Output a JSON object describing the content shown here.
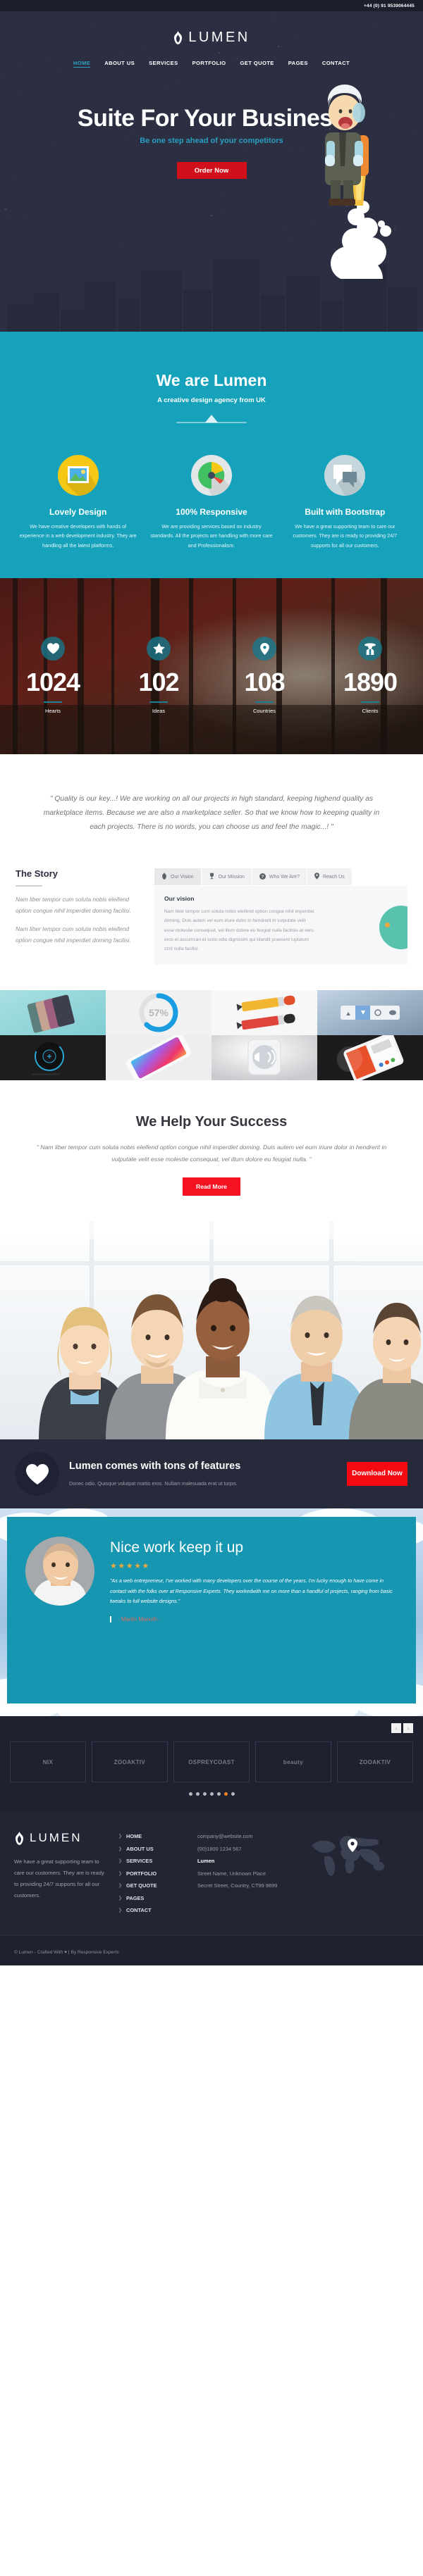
{
  "topbar": {
    "phone": "+44 (0) 91 9539064445"
  },
  "brand": {
    "name": "LUMEN",
    "icon": "flame-icon"
  },
  "nav": {
    "items": [
      {
        "label": "HOME",
        "active": true
      },
      {
        "label": "ABOUT US",
        "active": false
      },
      {
        "label": "SERVICES",
        "active": false
      },
      {
        "label": "PORTFOLIO",
        "active": false
      },
      {
        "label": "GET QUOTE",
        "active": false
      },
      {
        "label": "PAGES",
        "active": false
      },
      {
        "label": "CONTACT",
        "active": false
      }
    ]
  },
  "hero": {
    "title": "Suite For Your Business",
    "subtitle": "Be one step ahead of your competitors",
    "cta": "Order Now",
    "accent": "#2a9ec0",
    "cta_color": "#d0111b",
    "bg": "#2b2f41"
  },
  "about": {
    "heading": "We are Lumen",
    "lead": "A creative design agency from UK",
    "bg": "#17a2bc",
    "features": [
      {
        "icon": "image-icon",
        "title": "Lovely Design",
        "text": "We have creative developers with hands of experience in a web development industry. They are handling all the latest platforms."
      },
      {
        "icon": "pie-chart-icon",
        "title": "100% Responsive",
        "text": "We are providing services based on industry standards. All the projects are handling with more care and Professionalism."
      },
      {
        "icon": "chat-bubble-icon",
        "title": "Built with Bootstrap",
        "text": "We have a great supporting team to care our customers. They are is ready to providing 24/7 supports for all our customers."
      }
    ]
  },
  "counters": [
    {
      "icon": "heart-icon",
      "glyph": "♥",
      "value": "1024",
      "label": "Hearts"
    },
    {
      "icon": "star-icon",
      "glyph": "★",
      "value": "102",
      "label": "Ideas"
    },
    {
      "icon": "map-pin-icon",
      "glyph": "☰",
      "value": "108",
      "label": "Countries"
    },
    {
      "icon": "detective-icon",
      "glyph": "☃",
      "value": "1890",
      "label": "Clients"
    }
  ],
  "quote": {
    "text": "\" Quality is our key...! We are working on all our projects in high standard, keeping highend quality as marketplace items. Because we are also a marketplace seller. So that we know how to keeping quality in each projects. There is no words, you can choose us and feel the magic...! \""
  },
  "story": {
    "title": "The Story",
    "paragraphs": [
      "Nam liber tempor cum soluta nobis eleifend option congue nihil imperdiet doming facilisi.",
      "Nam liber tempor cum soluta nobis eleifend option congue nihil imperdiet doming facilisi."
    ],
    "tabs": [
      {
        "label": "Our Vision",
        "icon": "flame-icon",
        "glyph": "☘",
        "active": true
      },
      {
        "label": "Our Mission",
        "icon": "trophy-icon",
        "glyph": "♙",
        "active": false
      },
      {
        "label": "Who We Are?",
        "icon": "question-circle-icon",
        "glyph": "❓",
        "active": false
      },
      {
        "label": "Reach Us",
        "icon": "map-pin-icon",
        "glyph": "⚑",
        "active": false
      }
    ],
    "panel": {
      "heading": "Our vision",
      "text": "Nam liber tempor cum soluta nobis eleifend option congue nihil imperdiet doming. Duis autem vel eum iriure dolor in hendrerit in vulputate velit esse molestie consequat, vel illum dolore eu feugiat nulla facilisis at vero eros et accumsan et iusto odio dignissim qui blandit praesent luptatum zzril nulla facilisi."
    }
  },
  "portfolio": {
    "items": [
      {
        "name": "phone-cards-mockup",
        "label": ""
      },
      {
        "name": "progress-ring-57",
        "label": "57%"
      },
      {
        "name": "pencils-icon-set",
        "label": ""
      },
      {
        "name": "toolbar-ui-icons",
        "label": ""
      },
      {
        "name": "dark-dial-knob",
        "label": ""
      },
      {
        "name": "colorful-phone-mockup",
        "label": ""
      },
      {
        "name": "speaker-icon-3d",
        "label": ""
      },
      {
        "name": "orange-app-mockup",
        "label": ""
      }
    ]
  },
  "help": {
    "heading": "We Help Your Success",
    "text": "\" Nam liber tempor cum soluta nobis eleifend option congue nihil imperdiet doming. Duis autem vel eum iriure dolor in hendrerit in vulputate velit esse molestie consequat, vel illum dolore eu feugiat nulla. \"",
    "cta": "Read More",
    "cta_color": "#f51322"
  },
  "cta": {
    "icon": "heart-icon",
    "heading": "Lumen comes with tons of features",
    "text": "Donec odio. Quisque volutpat mattis eros. Nullam malesuada erat ut turpis.",
    "button": "Download Now",
    "button_color": "#f40913",
    "bg": "#262a3b"
  },
  "testimonial": {
    "heading": "Nice work keep it up",
    "rating": 5,
    "stars": "★★★★★",
    "text": "\"As a web entrepreneur, I've worked with many developers over the course of the years. I'm lucky enough to have come in contact with the folks over at Responsive Experts. They workedwith me on more than a handful of projects, ranging from basic tweaks to full website designs.\"",
    "author": "- Martin Manoth -",
    "bg": "#1796b1"
  },
  "clients": {
    "prev": "‹",
    "next": "›",
    "logos": [
      "NIX",
      "ZOOAKTIV",
      "OSPREYCOAST",
      "beauty",
      "ZOOAKTIV"
    ],
    "dots": 7,
    "active_dot": 5,
    "active_color": "#f0861e"
  },
  "footer": {
    "brand": "LUMEN",
    "about": "We have a great supporting team to care our customers. They are is ready to providing 24/7 supports for all our customers.",
    "links": [
      "HOME",
      "ABOUT US",
      "SERVICES",
      "PORTFOLIO",
      "GET QUOTE",
      "PAGES",
      "CONTACT"
    ],
    "contact": {
      "email": "company@website.com",
      "phone": "(00)1800 1234 567",
      "name": "Lumen",
      "address1": "Street Name, Unknown Place",
      "address2": "Secret Street, Country, CT99 9899"
    },
    "map_icon": "map-pin-icon",
    "copyright": "© Lumen - Crafted With ♥  | By Responsive Experts"
  }
}
